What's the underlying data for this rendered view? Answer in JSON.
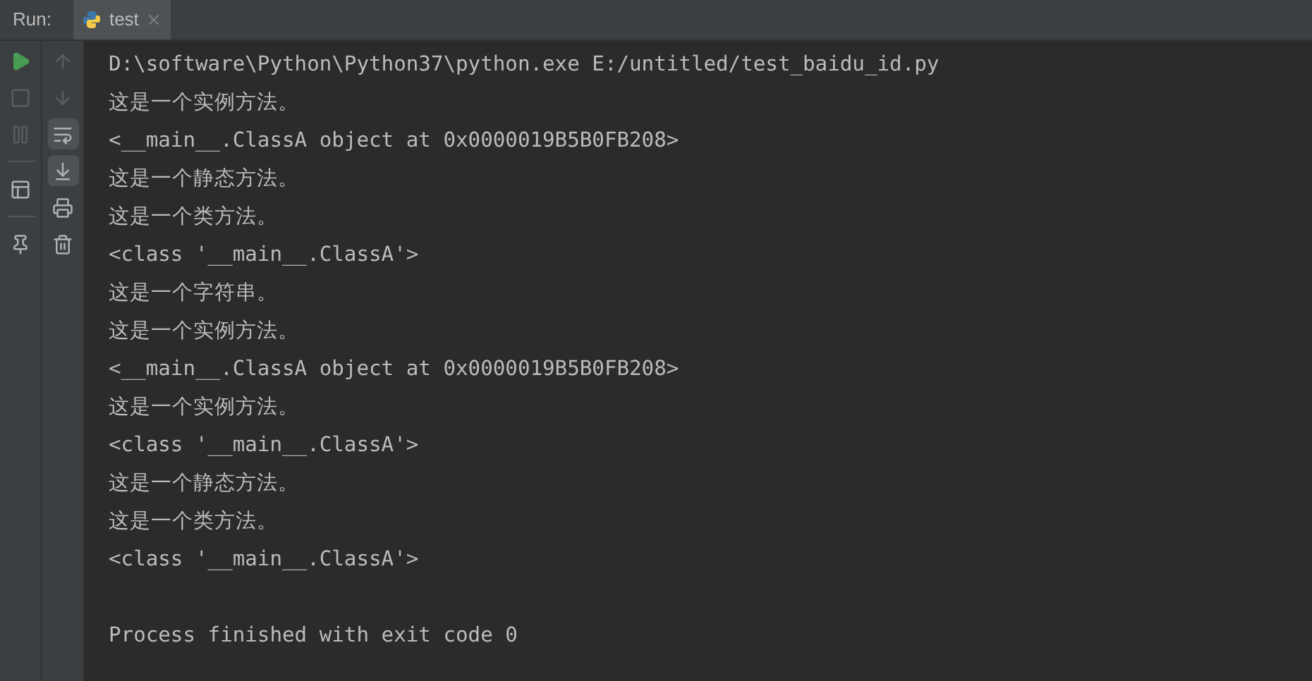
{
  "run_label": "Run:",
  "tab": {
    "label": "test",
    "selected": true
  },
  "toolbar_left": [
    {
      "kind": "rerun",
      "disabled": false
    },
    {
      "kind": "stop",
      "disabled": true
    },
    {
      "kind": "pause",
      "disabled": true
    },
    {
      "kind": "separator"
    },
    {
      "kind": "layout",
      "disabled": false
    },
    {
      "kind": "separator"
    },
    {
      "kind": "pin",
      "disabled": false
    }
  ],
  "toolbar_right": [
    {
      "kind": "up",
      "disabled": true,
      "selected": false
    },
    {
      "kind": "down",
      "disabled": true,
      "selected": false
    },
    {
      "kind": "wrap",
      "disabled": false,
      "selected": true
    },
    {
      "kind": "scroll-end",
      "disabled": false,
      "selected": true
    },
    {
      "kind": "print",
      "disabled": false,
      "selected": false
    },
    {
      "kind": "trash",
      "disabled": false,
      "selected": false
    }
  ],
  "console_lines": [
    "D:\\software\\Python\\Python37\\python.exe E:/untitled/test_baidu_id.py",
    "这是一个实例方法。",
    "<__main__.ClassA object at 0x0000019B5B0FB208>",
    "这是一个静态方法。",
    "这是一个类方法。",
    "<class '__main__.ClassA'>",
    "这是一个字符串。",
    "这是一个实例方法。",
    "<__main__.ClassA object at 0x0000019B5B0FB208>",
    "这是一个实例方法。",
    "<class '__main__.ClassA'>",
    "这是一个静态方法。",
    "这是一个类方法。",
    "<class '__main__.ClassA'>"
  ],
  "exit_message": "Process finished with exit code 0"
}
